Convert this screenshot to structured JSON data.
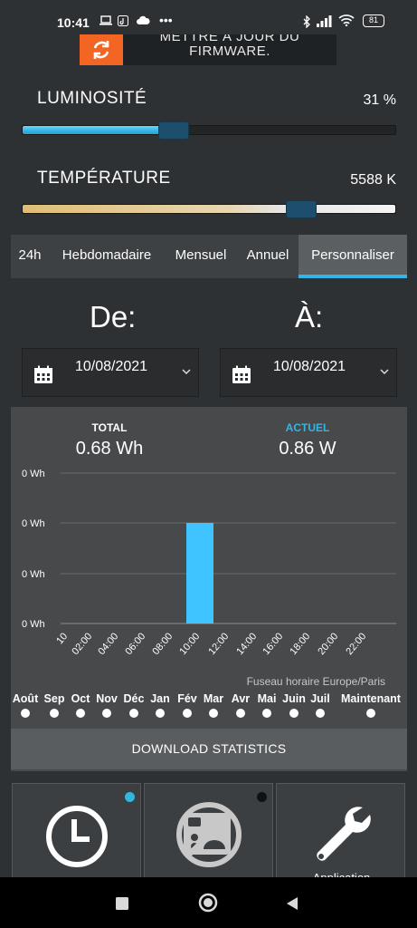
{
  "status_bar": {
    "time": "10:41",
    "battery": "81",
    "more": "•••"
  },
  "banner": {
    "line1": "METTRE À JOUR DU",
    "line2": "FIRMWARE.",
    "icon": "refresh-icon",
    "icon_color": "#f26522"
  },
  "brightness": {
    "label": "LUMINOSITÉ",
    "value_text": "31 %",
    "level": 0.31
  },
  "temperature": {
    "label": "TEMPÉRATURE",
    "value_text": "5588 K",
    "level": 0.73
  },
  "tabs": [
    {
      "label": "24h"
    },
    {
      "label": "Hebdomadaire"
    },
    {
      "label": "Mensuel"
    },
    {
      "label": "Annuel"
    },
    {
      "label": "Personnaliser",
      "active": true
    }
  ],
  "range": {
    "from_label": "De:",
    "to_label": "À:",
    "from_date": "10/08/2021",
    "to_date": "10/08/2021"
  },
  "stats": {
    "total_label": "TOTAL",
    "total_value": "0.68 Wh",
    "current_label": "ACTUEL",
    "current_value": "0.86 W",
    "accent": "#33b5e5"
  },
  "chart_data": {
    "type": "bar",
    "categories": [
      "10",
      "02:00",
      "04:00",
      "06:00",
      "08:00",
      "10:00",
      "12:00",
      "14:00",
      "16:00",
      "18:00",
      "20:00",
      "22:00"
    ],
    "values": [
      0,
      0,
      0,
      0,
      0,
      0.68,
      0,
      0,
      0,
      0,
      0,
      0
    ],
    "y_ticks": [
      "0 Wh",
      "0 Wh",
      "0 Wh",
      "0 Wh"
    ],
    "ylim": [
      0,
      1
    ],
    "bar_color": "#40c4ff",
    "grid": true
  },
  "timezone": "Fuseau horaire Europe/Paris",
  "months": [
    "Août",
    "Sep",
    "Oct",
    "Nov",
    "Déc",
    "Jan",
    "Fév",
    "Mar",
    "Avr",
    "Mai",
    "Juin",
    "Juil",
    "Maintenant"
  ],
  "download_button": "DOWNLOAD STATISTICS",
  "tiles": [
    {
      "icon": "clock-icon",
      "dot_color": "#33b5e5",
      "label": ""
    },
    {
      "icon": "no-display-icon",
      "dot_color": "#111111",
      "label": ""
    },
    {
      "icon": "wrench-icon",
      "label": "Application"
    }
  ],
  "nav": [
    "square-icon",
    "circle-icon",
    "back-triangle-icon"
  ]
}
